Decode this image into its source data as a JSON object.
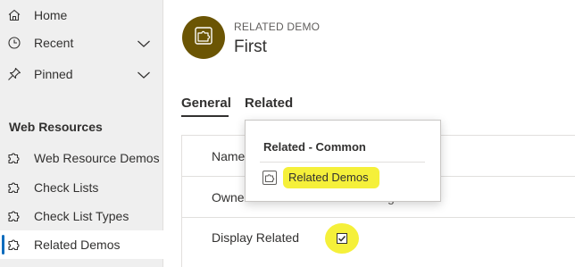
{
  "sidebar": {
    "items": [
      {
        "label": "Home",
        "icon": "home-icon"
      },
      {
        "label": "Recent",
        "icon": "clock-icon",
        "expandable": true
      },
      {
        "label": "Pinned",
        "icon": "pin-icon",
        "expandable": true
      }
    ],
    "group_title": "Web Resources",
    "group_items": [
      {
        "label": "Web Resource Demos",
        "icon": "puzzle-icon"
      },
      {
        "label": "Check Lists",
        "icon": "puzzle-icon"
      },
      {
        "label": "Check List Types",
        "icon": "puzzle-icon"
      },
      {
        "label": "Related Demos",
        "icon": "puzzle-icon",
        "selected": true
      }
    ]
  },
  "header": {
    "entity_type": "RELATED DEMO",
    "record_title": "First"
  },
  "tabs": [
    {
      "label": "General",
      "active": true
    },
    {
      "label": "Related",
      "active": false
    }
  ],
  "form": {
    "fields": [
      {
        "label": "Name"
      },
      {
        "label": "Owner",
        "value": "g"
      },
      {
        "label": "Display Related",
        "checked": true
      }
    ]
  },
  "related_menu": {
    "header": "Related - Common",
    "items": [
      {
        "label": "Related Demos",
        "icon": "puzzle-icon"
      }
    ]
  },
  "colors": {
    "avatar": "#6b5504",
    "highlight": "#f5f03a",
    "selected_bar": "#0f6cbd",
    "sidebar_bg": "#efefef"
  }
}
